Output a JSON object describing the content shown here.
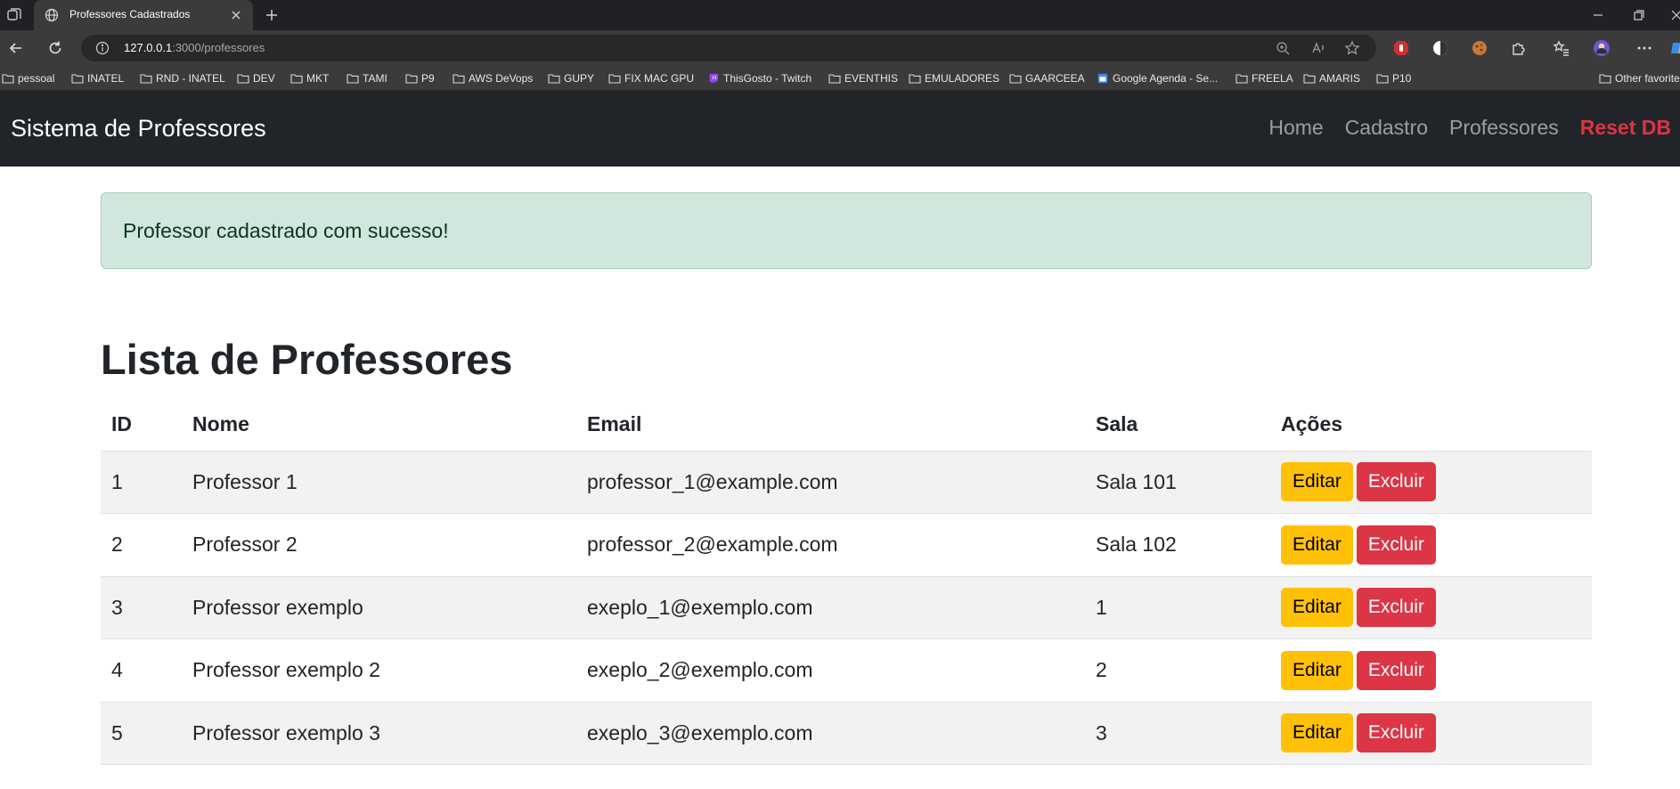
{
  "browser": {
    "tab_title": "Professores Cadastrados",
    "url_host": "127.0.0.1",
    "url_rest": ":3000/professores",
    "bookmarks": [
      "pessoal",
      "INATEL",
      "RND - INATEL",
      "DEV",
      "MKT",
      "TAMI",
      "P9",
      "AWS DeVops",
      "GUPY",
      "FIX MAC GPU",
      "ThisGosto - Twitch",
      "EVENTHIS",
      "EMULADORES",
      "GAARCEEA",
      "Google Agenda - Se...",
      "FREELA",
      "AMARIS",
      "P10"
    ],
    "other_favorites": "Other favorites"
  },
  "navbar": {
    "brand": "Sistema de Professores",
    "links": [
      "Home",
      "Cadastro",
      "Professores"
    ],
    "reset": "Reset DB"
  },
  "alert": "Professor cadastrado com sucesso!",
  "heading": "Lista de Professores",
  "table": {
    "headers": [
      "ID",
      "Nome",
      "Email",
      "Sala",
      "Ações"
    ],
    "rows": [
      {
        "id": "1",
        "nome": "Professor 1",
        "email": "professor_1@example.com",
        "sala": "Sala 101"
      },
      {
        "id": "2",
        "nome": "Professor 2",
        "email": "professor_2@example.com",
        "sala": "Sala 102"
      },
      {
        "id": "3",
        "nome": "Professor exemplo",
        "email": "exeplo_1@exemplo.com",
        "sala": "1"
      },
      {
        "id": "4",
        "nome": "Professor exemplo 2",
        "email": "exeplo_2@exemplo.com",
        "sala": "2"
      },
      {
        "id": "5",
        "nome": "Professor exemplo 3",
        "email": "exeplo_3@exemplo.com",
        "sala": "3"
      }
    ],
    "edit_label": "Editar",
    "delete_label": "Excluir"
  },
  "colors": {
    "navbar_bg": "#212529",
    "alert_bg": "#d1e7dd",
    "warning": "#ffc107",
    "danger": "#dc3545"
  }
}
